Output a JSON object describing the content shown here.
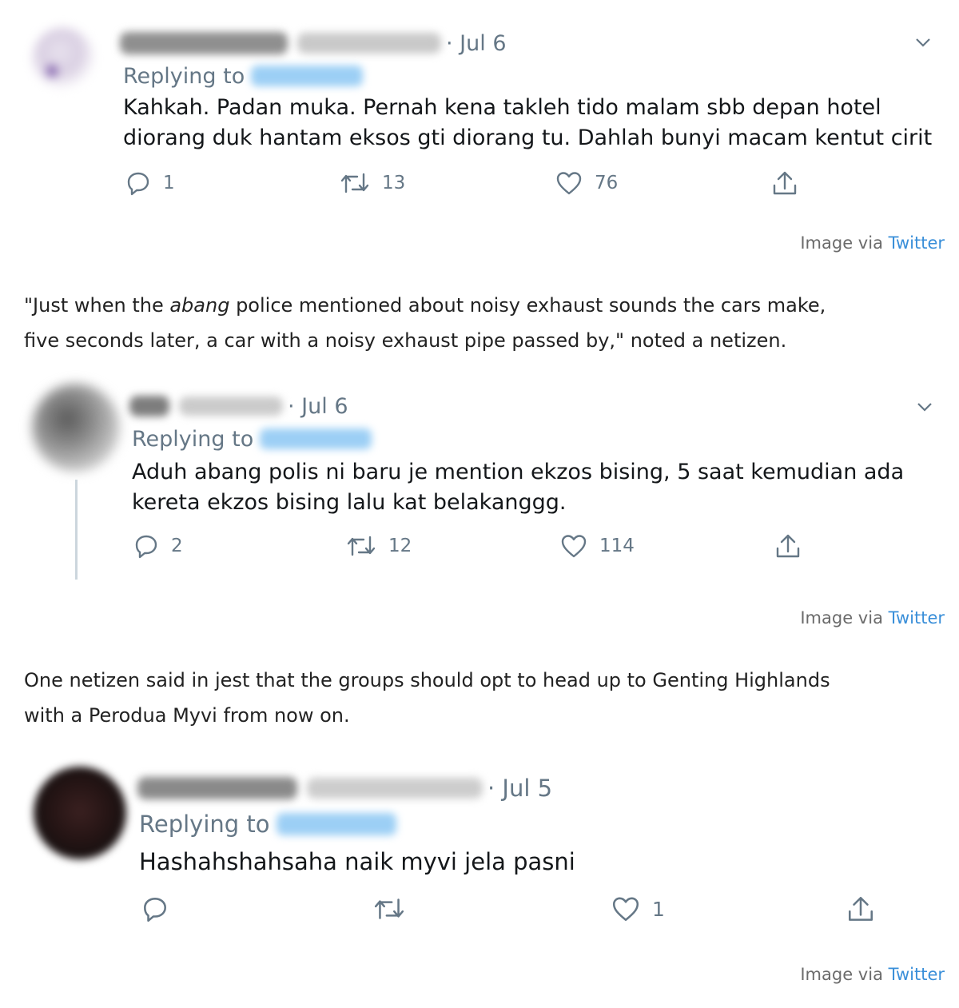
{
  "tweets": [
    {
      "date": "· Jul 6",
      "replying_label": "Replying to",
      "text_lines": [
        "Kahkah. Padan muka. Pernah kena takleh tido malam sbb depan hotel",
        "diorang duk hantam eksos gti diorang tu. Dahlah bunyi macam kentut cirit"
      ],
      "replies": "1",
      "retweets": "13",
      "likes": "76"
    },
    {
      "date": "· Jul 6",
      "replying_label": "Replying to",
      "text_lines": [
        "Aduh abang polis ni baru je mention ekzos bising, 5 saat kemudian ada",
        "kereta ekzos bising lalu kat belakanggg."
      ],
      "replies": "2",
      "retweets": "12",
      "likes": "114"
    },
    {
      "date": "· Jul 5",
      "replying_label": "Replying to",
      "text_lines": [
        "Hashahshahsaha naik myvi jela pasni"
      ],
      "replies": "",
      "retweets": "",
      "likes": "1"
    }
  ],
  "credit": {
    "prefix": "Image via ",
    "link": "Twitter"
  },
  "paragraphs": [
    {
      "line1_pre": "\"Just when the ",
      "line1_em": "abang",
      "line1_post": " police mentioned about noisy exhaust sounds the cars make,",
      "line2": "five seconds later, a car with a noisy exhaust pipe passed by,\" noted a netizen."
    },
    {
      "line1": "One netizen said in jest that the groups should opt to head up to Genting Highlands",
      "line2": "with a Perodua Myvi from now on."
    }
  ],
  "icons": {
    "reply": "reply-icon",
    "retweet": "retweet-icon",
    "like": "heart-icon",
    "share": "share-icon",
    "caret": "chevron-down-icon"
  },
  "colors": {
    "muted": "#657786",
    "link": "#3a8fd9",
    "handle_blur": "#9ccff5",
    "thread_line": "#ccd6dd"
  }
}
